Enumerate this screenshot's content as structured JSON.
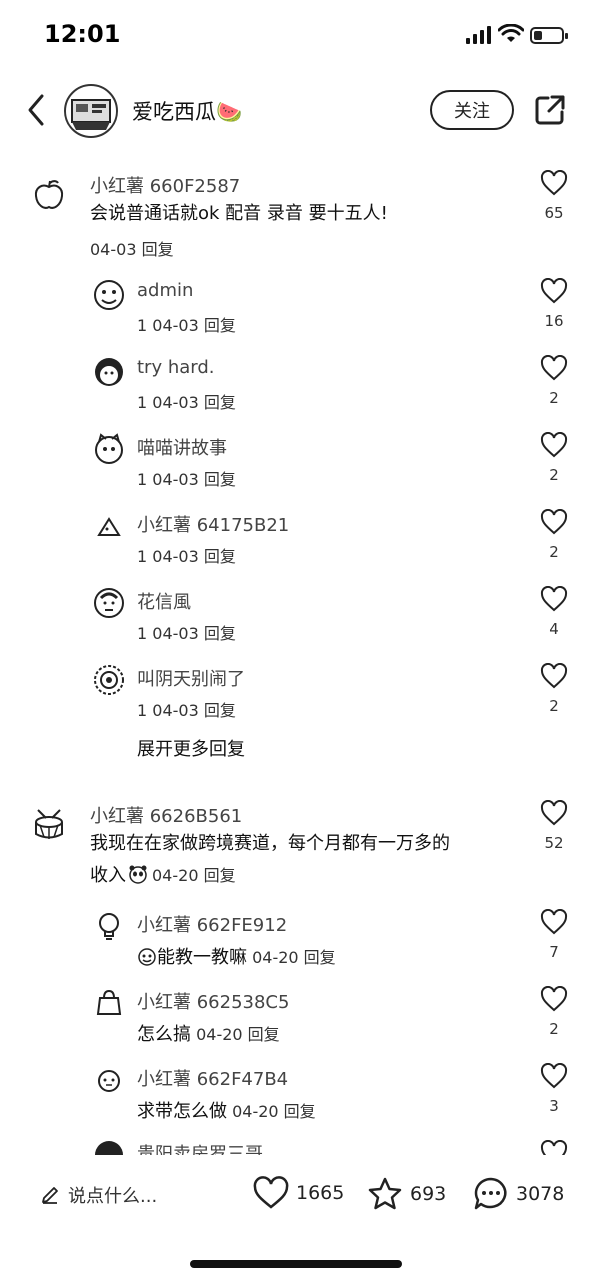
{
  "status_bar": {
    "time": "12:01",
    "battery_level": 0.3
  },
  "header": {
    "author": "爱吃西瓜🍉",
    "follow_label": "关注"
  },
  "comments": [
    {
      "user": "小红薯 660F2587",
      "text": "会说普通话就ok 配音 录音 要十五人!",
      "meta": "04-03 回复",
      "likes": "65",
      "avatar_icon": "apple-icon",
      "replies": [
        {
          "user": "admin",
          "meta": "1 04-03 回复",
          "likes": "16",
          "avatar_icon": "doodle-face-icon"
        },
        {
          "user": "try hard.",
          "meta": "1 04-03 回复",
          "likes": "2",
          "avatar_icon": "cartoon-head-icon"
        },
        {
          "user": "喵喵讲故事",
          "meta": "1 04-03 回复",
          "likes": "2",
          "avatar_icon": "cat-icon"
        },
        {
          "user": "小红薯 64175B21",
          "meta": "1 04-03 回复",
          "likes": "2",
          "avatar_icon": "triangle-icon"
        },
        {
          "user": "花信風",
          "meta": "1 04-03 回复",
          "likes": "4",
          "avatar_icon": "sketch-face-icon"
        },
        {
          "user": "叫阴天别闹了",
          "meta": "1 04-03 回复",
          "likes": "2",
          "avatar_icon": "dotted-circle-icon"
        }
      ],
      "expand_label": "展开更多回复"
    },
    {
      "user": "小红薯 6626B561",
      "text_line1": "我现在在家做跨境赛道，每个月都有一万多的",
      "text_line2": "收入",
      "meta": "04-20 回复",
      "likes": "52",
      "avatar_icon": "drum-icon",
      "replies": [
        {
          "user": "小红薯 662FE912",
          "text": "能教一教嘛",
          "meta": "04-20 回复",
          "likes": "7",
          "avatar_icon": "lightbulb-icon"
        },
        {
          "user": "小红薯 662538C5",
          "text": "怎么搞",
          "meta": "04-20 回复",
          "likes": "2",
          "avatar_icon": "bag-icon"
        },
        {
          "user": "小红薯 662F47B4",
          "text": "求带怎么做",
          "meta": "04-20 回复",
          "likes": "3",
          "avatar_icon": "face-icon"
        },
        {
          "user": "贵阳卖房罗三哥",
          "likes": "",
          "avatar_icon": "avatar-partial-icon"
        }
      ]
    }
  ],
  "bottom_bar": {
    "input_placeholder": "说点什么...",
    "likes": "1665",
    "favorites": "693",
    "comments": "3078"
  }
}
